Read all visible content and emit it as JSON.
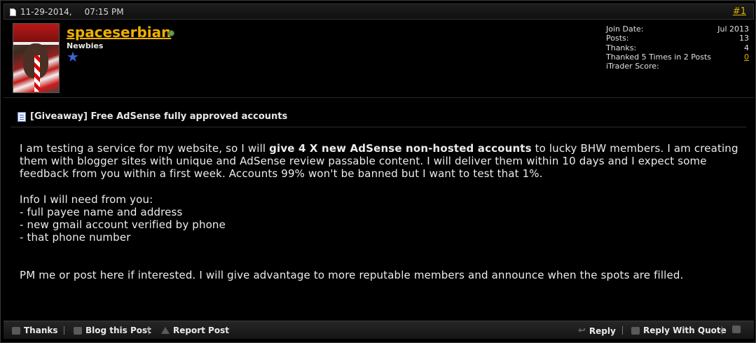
{
  "header": {
    "date": "11-29-2014,",
    "time": "07:15 PM",
    "post_number": "#1"
  },
  "user": {
    "username": "spaceserbian",
    "title": "Newbies",
    "stats": [
      {
        "label": "Join Date:",
        "value": "Jul 2013"
      },
      {
        "label": "Posts:",
        "value": "13"
      },
      {
        "label": "Thanks:",
        "value": "4"
      },
      {
        "label": "Thanked 5 Times in 2 Posts",
        "value": "0"
      },
      {
        "label": "iTrader Score:",
        "value": ""
      }
    ]
  },
  "post": {
    "title": "[Giveaway] Free AdSense fully approved accounts",
    "para1_pre": "I am testing a service for my website, so I will ",
    "para1_bold": "give 4 X new AdSense non-hosted accounts",
    "para1_post": " to lucky BHW members. I am creating them with blogger sites with unique and AdSense review passable content. I will deliver them within 10 days and I expect some feedback from you within a first week. Accounts 99% won't be banned but I want to test that 1%.",
    "info_heading": "Info I will need from you:",
    "info_items": [
      "- full payee name and address",
      "- new gmail account verified by phone",
      "- that phone number"
    ],
    "closing": "PM me or post here if interested. I will give advantage to more reputable members and announce when the spots are filled."
  },
  "footer": {
    "thanks": "Thanks",
    "blog": "Blog this Post",
    "report": "Report Post",
    "reply": "Reply",
    "reply_quote": "Reply With Quote"
  },
  "colors": {
    "accent": "#f0b000",
    "link": "#e0b000",
    "background": "#000000"
  }
}
